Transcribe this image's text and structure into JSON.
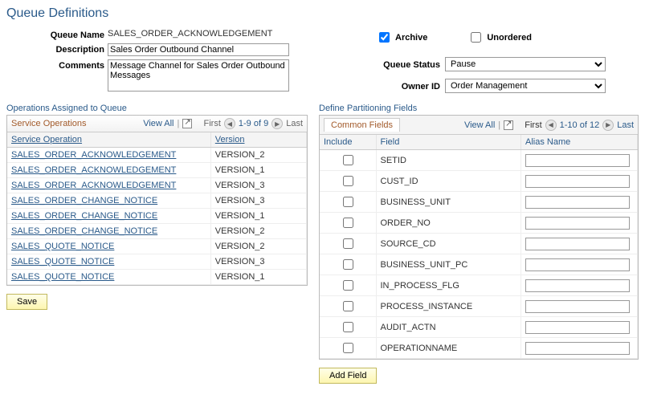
{
  "page": {
    "title": "Queue Definitions"
  },
  "header": {
    "queue_name_label": "Queue Name",
    "queue_name_value": "SALES_ORDER_ACKNOWLEDGEMENT",
    "description_label": "Description",
    "description_value": "Sales Order Outbound Channel",
    "comments_label": "Comments",
    "comments_value": "Message Channel for Sales Order Outbound Messages",
    "archive_label": "Archive",
    "archive_checked": true,
    "unordered_label": "Unordered",
    "unordered_checked": false,
    "queue_status_label": "Queue Status",
    "queue_status_value": "Pause",
    "owner_id_label": "Owner ID",
    "owner_id_value": "Order Management"
  },
  "ops_section": {
    "title": "Operations Assigned to Queue",
    "grid_title": "Service Operations",
    "view_all": "View All",
    "first": "First",
    "range": "1-9 of 9",
    "last": "Last",
    "cols": {
      "op": "Service Operation",
      "ver": "Version"
    },
    "rows": [
      {
        "op": "SALES_ORDER_ACKNOWLEDGEMENT",
        "ver": "VERSION_2"
      },
      {
        "op": "SALES_ORDER_ACKNOWLEDGEMENT",
        "ver": "VERSION_1"
      },
      {
        "op": "SALES_ORDER_ACKNOWLEDGEMENT",
        "ver": "VERSION_3"
      },
      {
        "op": "SALES_ORDER_CHANGE_NOTICE",
        "ver": "VERSION_3"
      },
      {
        "op": "SALES_ORDER_CHANGE_NOTICE",
        "ver": "VERSION_1"
      },
      {
        "op": "SALES_ORDER_CHANGE_NOTICE",
        "ver": "VERSION_2"
      },
      {
        "op": "SALES_QUOTE_NOTICE",
        "ver": "VERSION_2"
      },
      {
        "op": "SALES_QUOTE_NOTICE",
        "ver": "VERSION_3"
      },
      {
        "op": "SALES_QUOTE_NOTICE",
        "ver": "VERSION_1"
      }
    ]
  },
  "part_section": {
    "title": "Define Partitioning Fields",
    "tab": "Common Fields",
    "view_all": "View All",
    "first": "First",
    "range": "1-10 of 12",
    "last": "Last",
    "cols": {
      "inc": "Include",
      "field": "Field",
      "alias": "Alias Name"
    },
    "rows": [
      {
        "field": "SETID",
        "inc": false,
        "alias": ""
      },
      {
        "field": "CUST_ID",
        "inc": false,
        "alias": ""
      },
      {
        "field": "BUSINESS_UNIT",
        "inc": false,
        "alias": ""
      },
      {
        "field": "ORDER_NO",
        "inc": false,
        "alias": ""
      },
      {
        "field": "SOURCE_CD",
        "inc": false,
        "alias": ""
      },
      {
        "field": "BUSINESS_UNIT_PC",
        "inc": false,
        "alias": ""
      },
      {
        "field": "IN_PROCESS_FLG",
        "inc": false,
        "alias": ""
      },
      {
        "field": "PROCESS_INSTANCE",
        "inc": false,
        "alias": ""
      },
      {
        "field": "AUDIT_ACTN",
        "inc": false,
        "alias": ""
      },
      {
        "field": "OPERATIONNAME",
        "inc": false,
        "alias": ""
      }
    ]
  },
  "buttons": {
    "save": "Save",
    "add_field": "Add Field"
  }
}
